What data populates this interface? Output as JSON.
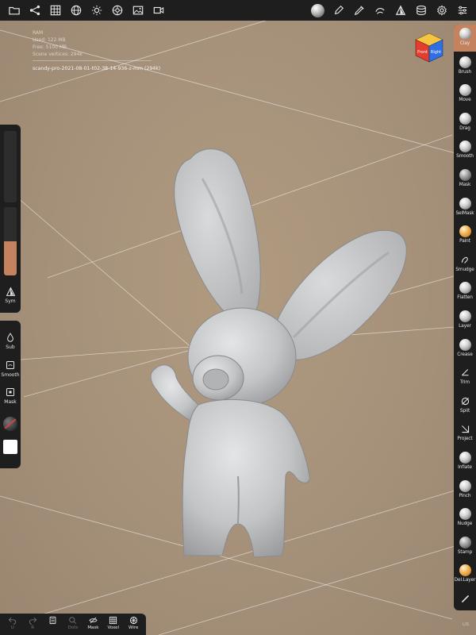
{
  "top_bar": {
    "left_icons": [
      "folder-icon",
      "share-icon",
      "grid-icon",
      "globe-icon",
      "sun-icon",
      "settings-gear-icon",
      "image-icon",
      "video-icon"
    ],
    "right_icons": [
      "matcap-sphere-icon",
      "pen-icon",
      "brush-pen-icon",
      "layers-stroke-icon",
      "triangle-split-icon",
      "stack-icon",
      "gear-icon",
      "sliders-icon"
    ]
  },
  "info": {
    "ram_label": "RAM",
    "used": "Used: 122 MB",
    "free": "Free: 5100 MB",
    "scene_vertices": "Scene vertices: 294k",
    "filename": "scandy-pro-2021-08-01-t02-38-14-936-z-mm (294k)"
  },
  "view_cube": {
    "top_color": "#f5c542",
    "left_face_label": "Front",
    "left_face_color": "#e33d2f",
    "right_face_label": "Right",
    "right_face_color": "#2f6ee3"
  },
  "tools": [
    {
      "label": "Clay",
      "icon": "clay-ball-icon",
      "active": true,
      "style": "light"
    },
    {
      "label": "Brush",
      "icon": "brush-ball-icon",
      "active": false,
      "style": "light"
    },
    {
      "label": "Move",
      "icon": "move-ball-icon",
      "active": false,
      "style": "light"
    },
    {
      "label": "Drag",
      "icon": "drag-ball-icon",
      "active": false,
      "style": "light"
    },
    {
      "label": "Smooth",
      "icon": "smooth-ball-icon",
      "active": false,
      "style": "light"
    },
    {
      "label": "Mask",
      "icon": "mask-ball-icon",
      "active": false,
      "style": "dark"
    },
    {
      "label": "SelMask",
      "icon": "selmask-ball-icon",
      "active": false,
      "style": "light"
    },
    {
      "label": "Paint",
      "icon": "paint-ball-icon",
      "active": false,
      "style": "orange"
    },
    {
      "label": "Smudge",
      "icon": "smudge-icon",
      "active": false,
      "style": "glyph"
    },
    {
      "label": "Flatten",
      "icon": "flatten-ball-icon",
      "active": false,
      "style": "light"
    },
    {
      "label": "Layer",
      "icon": "layer-ball-icon",
      "active": false,
      "style": "light"
    },
    {
      "label": "Crease",
      "icon": "crease-ball-icon",
      "active": false,
      "style": "light"
    },
    {
      "label": "Trim",
      "icon": "trim-icon",
      "active": false,
      "style": "glyph"
    },
    {
      "label": "Split",
      "icon": "split-icon",
      "active": false,
      "style": "glyph"
    },
    {
      "label": "Project",
      "icon": "project-icon",
      "active": false,
      "style": "glyph"
    },
    {
      "label": "Inflate",
      "icon": "inflate-ball-icon",
      "active": false,
      "style": "light"
    },
    {
      "label": "Pinch",
      "icon": "pinch-ball-icon",
      "active": false,
      "style": "light"
    },
    {
      "label": "Nudge",
      "icon": "nudge-ball-icon",
      "active": false,
      "style": "light"
    },
    {
      "label": "Stamp",
      "icon": "stamp-ball-icon",
      "active": false,
      "style": "dark"
    },
    {
      "label": "Del.Layer",
      "icon": "dellayer-ball-icon",
      "active": false,
      "style": "orange"
    },
    {
      "label": "",
      "icon": "brush-stroke-icon",
      "active": false,
      "style": "glyph"
    }
  ],
  "left_panel": {
    "intensity_fill": 0.5,
    "sym_label": "Sym",
    "sub_label": "Sub",
    "smooth_label": "Smooth",
    "mask_label": "Mask",
    "swatch_color": "#ffffff"
  },
  "bottom_bar": {
    "items": [
      {
        "label": "U",
        "icon": "undo-icon",
        "disabled": true
      },
      {
        "label": "R",
        "icon": "redo-icon",
        "disabled": true
      },
      {
        "label": "",
        "icon": "trash-icon",
        "disabled": false
      },
      {
        "label": "Dots",
        "icon": "search-icon",
        "disabled": true
      },
      {
        "label": "Mask",
        "icon": "mask-eye-icon",
        "disabled": false
      },
      {
        "label": "Voxel",
        "icon": "voxel-grid-icon",
        "disabled": false
      },
      {
        "label": "Wire",
        "icon": "wireframe-icon",
        "disabled": false
      }
    ]
  },
  "bottom_right_text": "LIS",
  "colors": {
    "background": "#a89478",
    "panel": "#1e1e1e",
    "accent": "#c4835e",
    "model": "#c9cacb"
  }
}
